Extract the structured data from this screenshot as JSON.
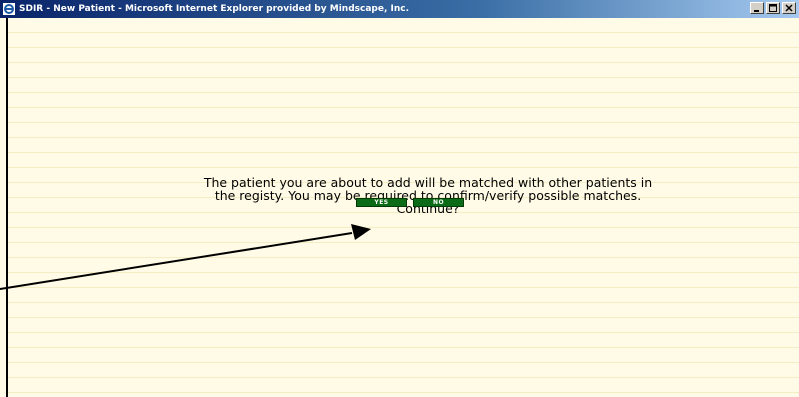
{
  "window": {
    "title": "SDIR - New Patient - Microsoft Internet Explorer provided by Mindscape, Inc.",
    "icon": "ie-icon",
    "controls": [
      "minimize-icon",
      "maximize-icon",
      "close-icon"
    ]
  },
  "dialog": {
    "line1": "The patient you are about to add will be matched with other patients in",
    "line2": "the registy. You may be required to confirm/verify possible matches.",
    "line3": "Continue?",
    "yes_label": "YES",
    "no_label": "NO"
  },
  "colors": {
    "page_background": "#fffbe6",
    "button_green": "#0b6b16",
    "titlebar": "#0a246a"
  }
}
